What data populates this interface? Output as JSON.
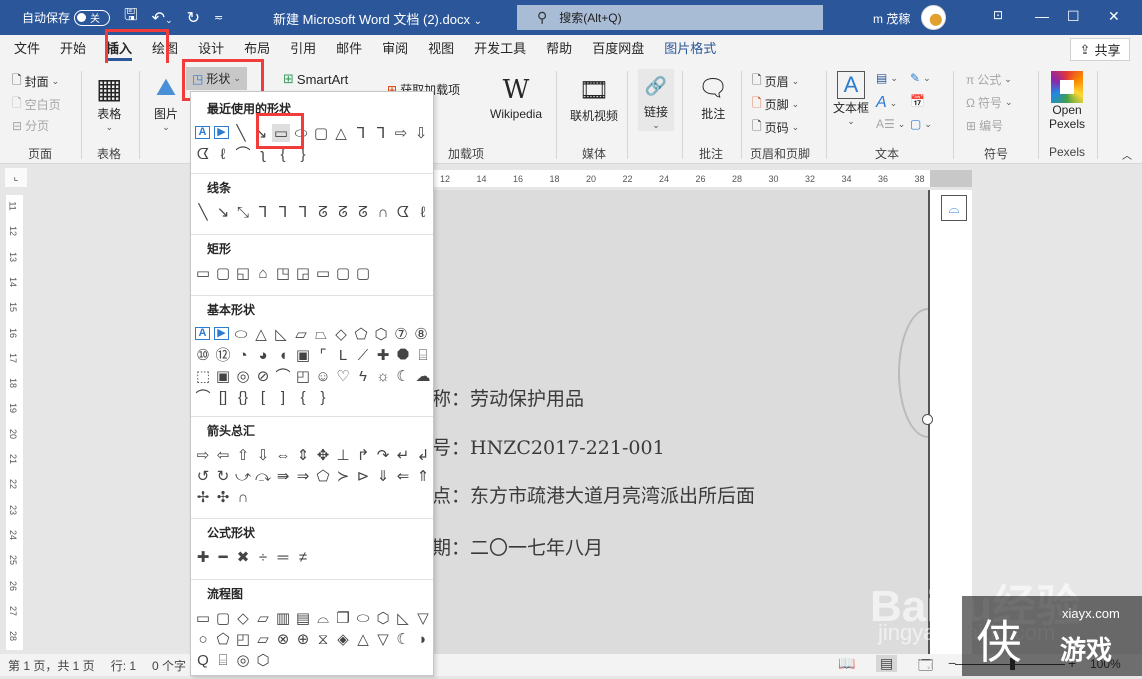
{
  "titlebar": {
    "autosave_label": "自动保存",
    "autosave_state": "关",
    "doc_title": "新建 Microsoft Word 文档 (2).docx",
    "search_placeholder": "搜索(Alt+Q)",
    "user_name": "m 茂稼",
    "icons": {
      "save": "save-icon",
      "undo": "undo-icon",
      "redo": "redo-icon",
      "customize": "customize-qat-icon"
    }
  },
  "tabs": [
    {
      "label": "文件"
    },
    {
      "label": "开始"
    },
    {
      "label": "插入",
      "active": true
    },
    {
      "label": "绘图"
    },
    {
      "label": "设计"
    },
    {
      "label": "布局"
    },
    {
      "label": "引用"
    },
    {
      "label": "邮件"
    },
    {
      "label": "审阅"
    },
    {
      "label": "视图"
    },
    {
      "label": "开发工具"
    },
    {
      "label": "帮助"
    },
    {
      "label": "百度网盘"
    },
    {
      "label": "图片格式",
      "contextual": true
    }
  ],
  "share_label": "共享",
  "ribbon": {
    "pages": {
      "cover": "封面",
      "blank": "空白页",
      "break": "分页",
      "group": "页面"
    },
    "tables": {
      "table": "表格",
      "group": "表格"
    },
    "illustrations": {
      "pictures": "图片",
      "shapes": "形状",
      "smartart": "SmartArt"
    },
    "addins": {
      "get": "获取加载项",
      "my": "加载项",
      "wikipedia": "Wikipedia",
      "group": "加载项"
    },
    "media": {
      "video": "联机视频",
      "group": "媒体"
    },
    "links": {
      "link": "链接"
    },
    "comments": {
      "comment": "批注",
      "group": "批注"
    },
    "headerfooter": {
      "header": "页眉",
      "footer": "页脚",
      "pagenum": "页码",
      "group": "页眉和页脚"
    },
    "text": {
      "textbox": "文本框",
      "group": "文本"
    },
    "symbols": {
      "equation": "公式",
      "symbol": "符号",
      "number": "编号",
      "group": "符号"
    },
    "pexels": {
      "open": "Open",
      "pexels": "Pexels",
      "group": "Pexels"
    }
  },
  "shapes_menu": {
    "sections": [
      {
        "title": "最近使用的形状",
        "rows": [
          [
            "A",
            "▶",
            "╲",
            "↘",
            "▭",
            "⬭",
            "▢",
            "△",
            "⅂",
            "⅂",
            "⇨",
            "⇩"
          ],
          [
            "ᗧ",
            "ℓ",
            "⌒",
            "ʅ",
            "{",
            "}"
          ]
        ]
      },
      {
        "title": "线条",
        "rows": [
          [
            "╲",
            "↘",
            "⤡",
            "⅂",
            "⅂",
            "⅂",
            "ᘔ",
            "ᘔ",
            "ᘔ",
            "∩",
            "ᗧ",
            "ℓ"
          ]
        ]
      },
      {
        "title": "矩形",
        "rows": [
          [
            "▭",
            "▢",
            "◱",
            "⌂",
            "◳",
            "◲",
            "▭",
            "▢",
            "▢"
          ]
        ]
      },
      {
        "title": "基本形状",
        "rows": [
          [
            "A",
            "▶",
            "⬭",
            "△",
            "◺",
            "▱",
            "⏢",
            "◇",
            "⬠",
            "⬡",
            "⑦",
            "⑧"
          ],
          [
            "⑩",
            "⑫",
            "◔",
            "◕",
            "◖",
            "▣",
            "⌜",
            "L",
            "⟋",
            "✚",
            "⯃",
            "⌸"
          ],
          [
            "⬚",
            "▣",
            "◎",
            "⊘",
            "⌒",
            "◰",
            "☺",
            "♡",
            "ϟ",
            "☼",
            "☾",
            "☁"
          ],
          [
            "⌒",
            "[]",
            "{}",
            "[",
            "]",
            "{",
            "}"
          ]
        ]
      },
      {
        "title": "箭头总汇",
        "rows": [
          [
            "⇨",
            "⇦",
            "⇧",
            "⇩",
            "⇔",
            "⇕",
            "✥",
            "⊥",
            "↱",
            "↷",
            "↵",
            "↲"
          ],
          [
            "↺",
            "↻",
            "⤻",
            "⤼",
            "⇛",
            "⇒",
            "⬠",
            "≻",
            "⊳",
            "⇓",
            "⇐",
            "⇑"
          ],
          [
            "✢",
            "✣",
            "∩"
          ]
        ]
      },
      {
        "title": "公式形状",
        "rows": [
          [
            "✚",
            "━",
            "✖",
            "÷",
            "═",
            "≠"
          ]
        ]
      },
      {
        "title": "流程图",
        "rows": [
          [
            "▭",
            "▢",
            "◇",
            "▱",
            "▥",
            "▤",
            "⌓",
            "❐",
            "⬭",
            "⬡",
            "◺",
            "▽"
          ],
          [
            "○",
            "⬠",
            "◰",
            "⏥",
            "⊗",
            "⊕",
            "⧖",
            "◈",
            "△",
            "▽",
            "☾",
            "◗"
          ],
          [
            "Q",
            "⌸",
            "◎",
            "⬡"
          ]
        ]
      }
    ]
  },
  "ruler": {
    "h_ticks": [
      "12",
      "14",
      "16",
      "18",
      "20",
      "22",
      "24",
      "26",
      "28",
      "30",
      "32",
      "34",
      "36",
      "38"
    ],
    "v_ticks": [
      "11",
      "12",
      "13",
      "14",
      "15",
      "16",
      "17",
      "18",
      "19",
      "20",
      "21",
      "22",
      "23",
      "24",
      "25",
      "26",
      "27",
      "28"
    ]
  },
  "document": {
    "lines": [
      "称：劳动保护用品",
      "号：HNZC2017-221-001",
      "点：东方市疏港大道月亮湾派出所后面",
      "期：二〇一七年八月"
    ]
  },
  "statusbar": {
    "page": "第 1 页，共 1 页",
    "line": "行: 1",
    "words": "0 个字",
    "zoom": "100%"
  },
  "watermark": {
    "site": "xiayx.com",
    "glyph": "侠",
    "game": "游戏",
    "baidu": "Baidu经验",
    "baidu_sub": "jingyan.baidu.com"
  }
}
